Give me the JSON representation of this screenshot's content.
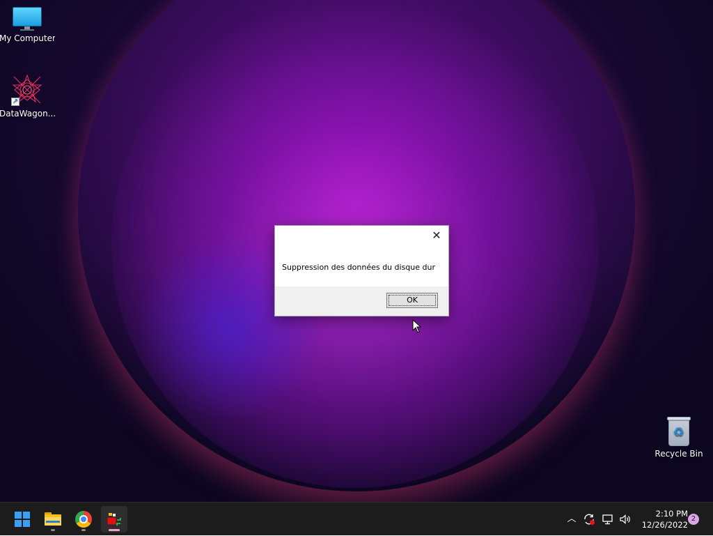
{
  "desktop": {
    "icons": [
      {
        "label": "My Computer",
        "icon": "monitor-icon"
      },
      {
        "label": "DataWagon...",
        "icon": "datawagon-icon"
      },
      {
        "label": "Recycle Bin",
        "icon": "recycle-bin-icon"
      }
    ]
  },
  "dialog": {
    "close_glyph": "✕",
    "message": "Suppression des données du disque dur",
    "ok_label": "OK"
  },
  "taskbar": {
    "apps": [
      {
        "name": "Start",
        "icon": "windows-logo-icon"
      },
      {
        "name": "File Explorer",
        "icon": "file-explorer-icon"
      },
      {
        "name": "Google Chrome",
        "icon": "chrome-icon"
      },
      {
        "name": "Running app",
        "icon": "app-icon"
      }
    ],
    "tray": {
      "overflow_glyph": "︿",
      "clock_time": "2:10 PM",
      "clock_date": "12/26/2022",
      "notification_count": "2"
    }
  },
  "colors": {
    "accent": "#3aa0f5",
    "taskbar_bg": "#1c1c1c",
    "dialog_footer": "#f0f0f0"
  }
}
